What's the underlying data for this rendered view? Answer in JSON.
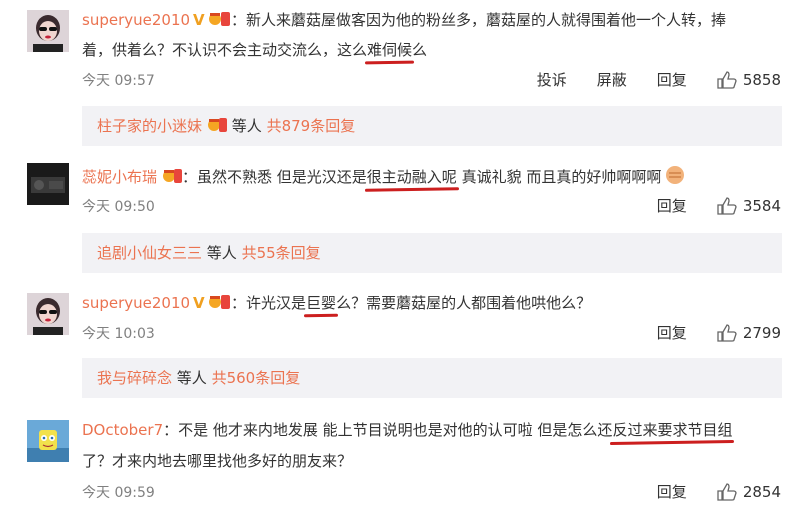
{
  "comments": [
    {
      "user": "superyue2010",
      "line1_a": "：新人来蘑菇屋做客因为他的粉丝多，蘑菇屋的人就得围着他一个人转，捧",
      "line2_a": "着，供着么？不认识不会主动交流么，这么",
      "line2_hl": "难伺候",
      "line2_b": "么",
      "time": "今天 09:57",
      "report": "投诉",
      "block": "屏蔽",
      "reply": "回复",
      "likes": "5858",
      "reply_user": "柱子家的小迷妹",
      "reply_mid": " 等人 ",
      "reply_count": "共879条回复"
    },
    {
      "user": "蕊妮小布瑞",
      "line1_a": "：虽然不熟悉 但是光汉还是",
      "line1_hl": "很主动融入呢",
      "line1_b": " 真诚礼貌 而且真的好帅啊啊啊",
      "time": "今天 09:50",
      "reply": "回复",
      "likes": "3584",
      "reply_user": "追剧小仙女三三",
      "reply_mid": " 等人 ",
      "reply_count": "共55条回复"
    },
    {
      "user": "superyue2010",
      "line1_a": "：许光汉是",
      "line1_hl": "巨婴",
      "line1_b": "么？需要蘑菇屋的人都围着他哄他么？",
      "time": "今天 10:03",
      "reply": "回复",
      "likes": "2799",
      "reply_user": "我与碎碎念",
      "reply_mid": " 等人 ",
      "reply_count": "共560条回复"
    },
    {
      "user": "DOctober7",
      "line1_a": "：不是 他才来内地发展 能上节目说明也是对他的认可啦 但是怎么还",
      "line1_hl": "反过来要求节目组",
      "line2_a": "了？才来内地去哪里找他多好的朋友来？",
      "time": "今天 09:59",
      "reply": "回复",
      "likes": "2854"
    }
  ],
  "colors": {
    "name": "#eb7350",
    "underline": "#cc1f1f",
    "replybg": "#f2f2f5"
  }
}
